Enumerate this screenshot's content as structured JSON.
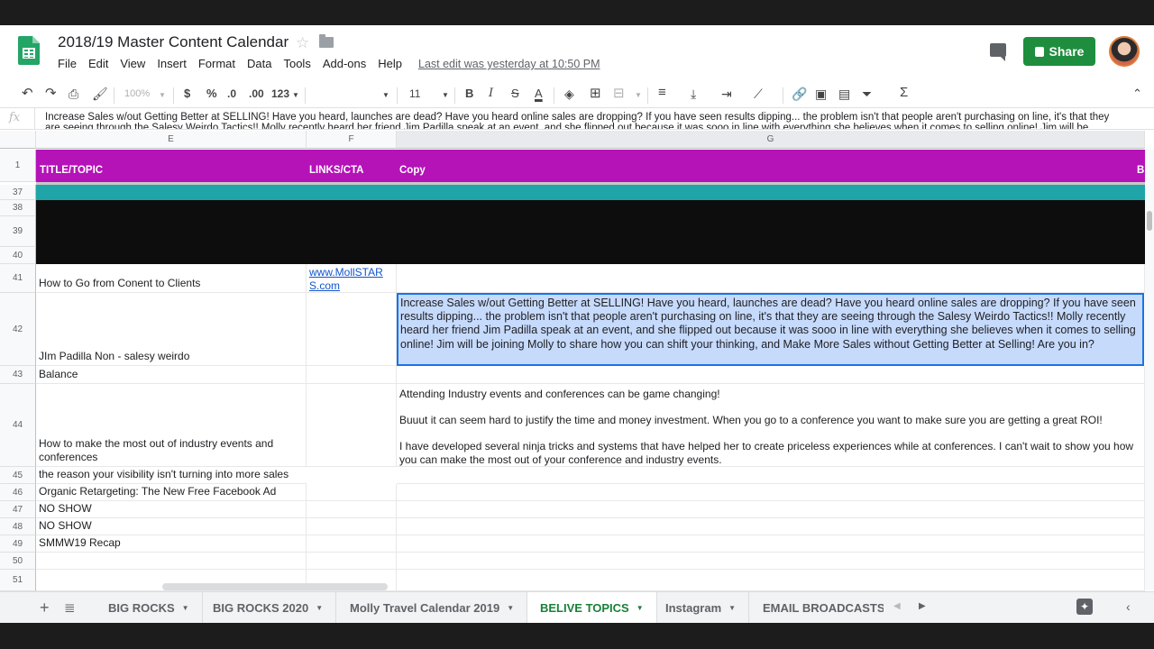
{
  "doc": {
    "title": "2018/19 Master Content Calendar",
    "last_edit": "Last edit was yesterday at 10:50 PM",
    "share_label": "Share"
  },
  "menu": [
    "File",
    "Edit",
    "View",
    "Insert",
    "Format",
    "Data",
    "Tools",
    "Add-ons",
    "Help"
  ],
  "toolbar": {
    "zoom": "100%",
    "currency": "$",
    "percent": "%",
    "dec_less": ".0",
    "dec_more": ".00",
    "format": "123",
    "font_size": "11",
    "bold": "B",
    "italic": "I",
    "strike": "S",
    "text_color": "A"
  },
  "formula": {
    "fx": "fx",
    "text": "Increase Sales w/out Getting Better at SELLING! Have you heard, launches are dead? Have you heard online sales are dropping? If you have seen results dipping... the problem isn't that people aren't purchasing on line, it's that they are seeing through the Salesy Weirdo Tactics!! Molly recently heard her friend Jim Padilla speak at an event, and she flipped out because it was sooo in line with everything she believes when it comes to selling online! Jim will be"
  },
  "columns": [
    "E",
    "F",
    "G"
  ],
  "header_row": {
    "num": "1",
    "e": "TITLE/TOPIC",
    "f": "LINKS/CTA",
    "g": "Copy",
    "h": "B"
  },
  "rows": {
    "r37": "37",
    "r38": "38",
    "r39": "39",
    "r40": "40",
    "r41": {
      "num": "41",
      "e": "How to Go from Conent to Clients",
      "f": "www.MollSTARS.com"
    },
    "r42": {
      "num": "42",
      "e": "JIm Padilla Non - salesy weirdo",
      "g": "Increase Sales w/out Getting Better at SELLING! Have you heard, launches are dead? Have you heard online sales are dropping? If you have seen results dipping... the problem isn't that people aren't purchasing on line, it's that they are seeing through the Salesy Weirdo Tactics!! Molly recently heard her friend Jim Padilla speak at an event, and she flipped out because it was sooo in line with everything she believes when it comes to selling online! Jim will be joining Molly to share how you can shift your thinking, and Make More Sales without Getting Better at Selling! Are you in?"
    },
    "r43": {
      "num": "43",
      "e": "Balance"
    },
    "r44": {
      "num": "44",
      "e": "How to make the most out of industry events and conferences",
      "g1": "Attending Industry events and conferences can be game changing!",
      "g2": "Buuut it can seem hard to justify the time and money investment. When you go to a conference you want to make sure you are getting a great ROI!",
      "g3": "I have developed several ninja tricks and systems that have helped her to create priceless experiences while at conferences. I can't wait to show you how you can make the most out of your conference and industry events."
    },
    "r45": {
      "num": "45",
      "e": "the reason your visibility isn't turning into more sales"
    },
    "r46": {
      "num": "46",
      "e": "Organic Retargeting: The New Free Facebook Ad"
    },
    "r47": {
      "num": "47",
      "e": "NO SHOW"
    },
    "r48": {
      "num": "48",
      "e": "NO SHOW"
    },
    "r49": {
      "num": "49",
      "e": "SMMW19 Recap"
    },
    "r50": {
      "num": "50"
    },
    "r51": {
      "num": "51"
    }
  },
  "tabs": [
    "BIG ROCKS",
    "BIG ROCKS 2020",
    "Molly Travel Calendar 2019",
    "BELIVE TOPICS",
    "Instagram",
    "EMAIL BROADCASTS"
  ],
  "colors": {
    "header_band": "#b512b8",
    "teal_band": "#1fa5a8",
    "black_band": "#0d0d0d",
    "share_green": "#1e8e3e",
    "active_tab": "#188038",
    "selection": "#c6dafc"
  }
}
